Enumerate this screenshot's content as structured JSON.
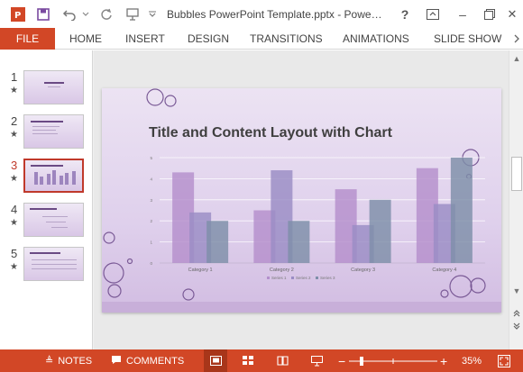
{
  "window": {
    "title": "Bubbles PowerPoint Template.pptx - Powe…",
    "help_label": "?",
    "minimize_label": "–",
    "close_label": "✕"
  },
  "ribbon": {
    "file_label": "FILE",
    "tabs": [
      "HOME",
      "INSERT",
      "DESIGN",
      "TRANSITIONS",
      "ANIMATIONS",
      "SLIDE SHOW"
    ]
  },
  "thumbnails": [
    {
      "number": "1",
      "star": "★",
      "active": false
    },
    {
      "number": "2",
      "star": "★",
      "active": false
    },
    {
      "number": "3",
      "star": "★",
      "active": true
    },
    {
      "number": "4",
      "star": "★",
      "active": false
    },
    {
      "number": "5",
      "star": "★",
      "active": false
    }
  ],
  "slide": {
    "title": "Title and Content Layout with Chart"
  },
  "chart_data": {
    "type": "bar",
    "categories": [
      "Category 1",
      "Category 2",
      "Category 3",
      "Category 4"
    ],
    "series": [
      {
        "name": "Series 1",
        "values": [
          4.3,
          2.5,
          3.5,
          4.5
        ],
        "color": "#b48fcc"
      },
      {
        "name": "Series 2",
        "values": [
          2.4,
          4.4,
          1.8,
          2.8
        ],
        "color": "#9a8cc4"
      },
      {
        "name": "Series 3",
        "values": [
          2,
          2,
          3,
          5
        ],
        "color": "#7e8fa8"
      }
    ],
    "ylim": [
      0,
      5
    ],
    "yticks": [
      "0",
      "1",
      "2",
      "3",
      "4",
      "5"
    ],
    "legend_position": "bottom",
    "grid": true
  },
  "statusbar": {
    "notes_label": "NOTES",
    "comments_label": "COMMENTS",
    "zoom_minus": "−",
    "zoom_plus": "+",
    "zoom_level": "35%"
  },
  "colors": {
    "accent": "#d24726",
    "slide_purple": "#7a5a96"
  }
}
